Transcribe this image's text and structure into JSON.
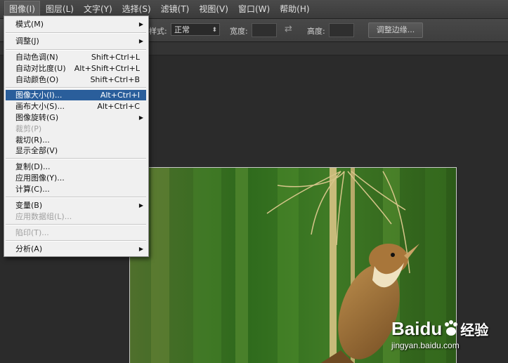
{
  "menubar": {
    "items": [
      {
        "label": "图像(I)",
        "active": true
      },
      {
        "label": "图层(L)"
      },
      {
        "label": "文字(Y)"
      },
      {
        "label": "选择(S)"
      },
      {
        "label": "滤镜(T)"
      },
      {
        "label": "视图(V)"
      },
      {
        "label": "窗口(W)"
      },
      {
        "label": "帮助(H)"
      }
    ]
  },
  "options_bar": {
    "style_label": "样式:",
    "style_value": "正常",
    "width_label": "宽度:",
    "height_label": "高度:",
    "refine_button": "调整边缘..."
  },
  "image_menu": {
    "items": [
      {
        "label": "模式(M)",
        "shortcut": "",
        "submenu": true
      },
      {
        "label": "调整(J)",
        "shortcut": "",
        "submenu": true
      },
      {
        "label": "自动色调(N)",
        "shortcut": "Shift+Ctrl+L"
      },
      {
        "label": "自动对比度(U)",
        "shortcut": "Alt+Shift+Ctrl+L"
      },
      {
        "label": "自动颜色(O)",
        "shortcut": "Shift+Ctrl+B"
      },
      {
        "label": "图像大小(I)...",
        "shortcut": "Alt+Ctrl+I",
        "highlighted": true
      },
      {
        "label": "画布大小(S)...",
        "shortcut": "Alt+Ctrl+C"
      },
      {
        "label": "图像旋转(G)",
        "shortcut": "",
        "submenu": true
      },
      {
        "label": "裁剪(P)",
        "shortcut": "",
        "disabled": true
      },
      {
        "label": "裁切(R)...",
        "shortcut": ""
      },
      {
        "label": "显示全部(V)",
        "shortcut": ""
      },
      {
        "label": "复制(D)...",
        "shortcut": ""
      },
      {
        "label": "应用图像(Y)...",
        "shortcut": ""
      },
      {
        "label": "计算(C)...",
        "shortcut": ""
      },
      {
        "label": "变量(B)",
        "shortcut": "",
        "submenu": true
      },
      {
        "label": "应用数据组(L)...",
        "shortcut": "",
        "disabled": true
      },
      {
        "label": "陷印(T)...",
        "shortcut": "",
        "disabled": true
      },
      {
        "label": "分析(A)",
        "shortcut": "",
        "submenu": true
      }
    ]
  },
  "watermark": {
    "brand": "Baidu",
    "cn": "经验",
    "url": "jingyan.baidu.com"
  },
  "colors": {
    "highlight": "#2a5e9b",
    "menu_bg": "#f0f0f0",
    "workspace": "#2b2b2b"
  }
}
